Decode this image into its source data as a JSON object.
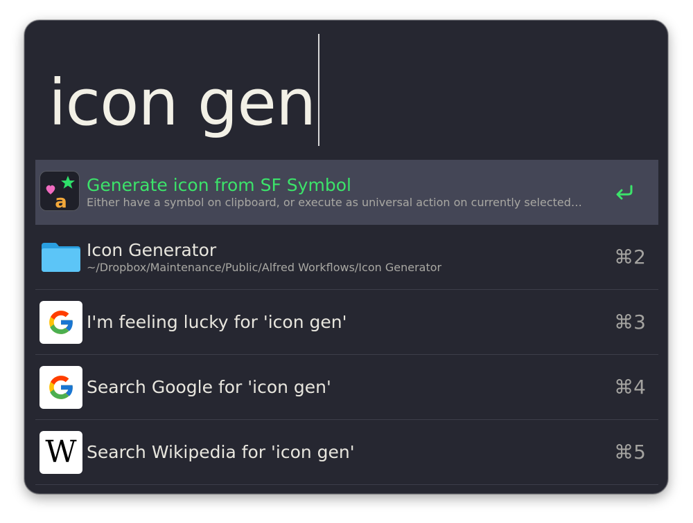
{
  "search": {
    "query": "icon gen"
  },
  "results": [
    {
      "title": "Generate icon from SF Symbol",
      "subtitle": "Either have a symbol on clipboard, or execute as universal action on currently selected…",
      "icon": "sf-symbol-app-icon",
      "action": "return-key"
    },
    {
      "title": "Icon Generator",
      "subtitle": "~/Dropbox/Maintenance/Public/Alfred Workflows/Icon Generator",
      "icon": "folder-icon",
      "shortcut": "⌘2"
    },
    {
      "title": "I'm feeling lucky for 'icon gen'",
      "icon": "google-icon",
      "shortcut": "⌘3"
    },
    {
      "title": "Search Google for 'icon gen'",
      "icon": "google-icon",
      "shortcut": "⌘4"
    },
    {
      "title": "Search Wikipedia for 'icon gen'",
      "icon": "wikipedia-icon",
      "icon_letter": "W",
      "shortcut": "⌘5"
    }
  ],
  "colors": {
    "window_bg": "#262731",
    "selected_row_bg": "#444656",
    "selected_title": "#3ce36a",
    "query_text": "#f2f0e6"
  }
}
